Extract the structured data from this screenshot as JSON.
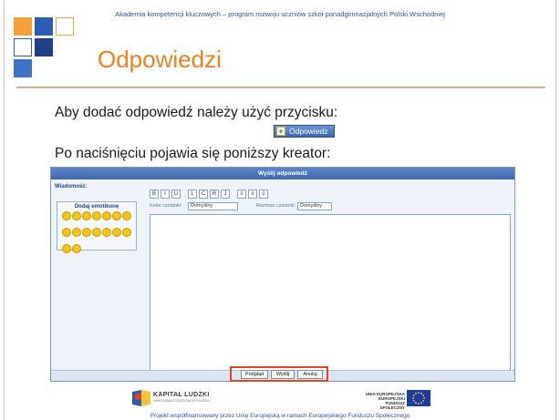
{
  "header": {
    "program": "Akademia kompetencji kluczowych – program rozwoju uczniów szkół ponadgimnazjalnych Polski Wschodniej",
    "title": "Odpowiedzi"
  },
  "body": {
    "line1": "Aby dodać odpowiedź należy użyć przycisku:",
    "button_label": "Odpowiedz",
    "line2": "Po naciśnięciu pojawia się poniższy kreator:"
  },
  "wizard": {
    "title": "Wyślij odpowiedź",
    "message_label": "Wiadomość:",
    "emoticons_title": "Dodaj emotikonę",
    "emoticon_count": 16,
    "toolbar": [
      "B",
      "I",
      "U",
      "L",
      "C",
      "R",
      "J",
      "≡",
      "≡",
      "≡"
    ],
    "font_color_label": "Kolor czcionki:",
    "font_color_value": "Domyślny",
    "font_size_label": "Rozmiar czcionki:",
    "font_size_value": "Domyślny",
    "actions": {
      "preview": "Podgląd",
      "send": "Wyślij",
      "cancel": "Anuluj"
    }
  },
  "footer": {
    "left_logo": "KAPITAŁ LUDZKI",
    "left_logo_sub": "NARODOWA STRATEGIA SPÓJNOŚCI",
    "right_logo": "UNIA EUROPEJSKA\nEUROPEJSKI\nFUNDUSZ SPOŁECZNY",
    "note": "Projekt współfinansowany przez Unię Europejską w ramach Europejskiego Funduszu Społecznego"
  },
  "colors": {
    "accent_orange": "#f07f1e",
    "accent_blue": "#2a5db0",
    "highlight_red": "#e2461e"
  }
}
